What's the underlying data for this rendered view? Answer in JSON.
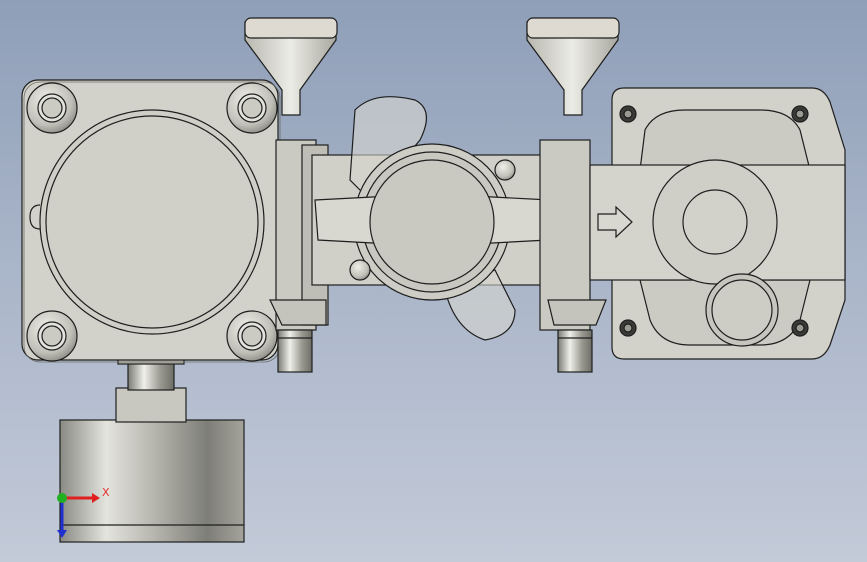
{
  "viewport": {
    "background_top": "#8f9fb8",
    "background_bottom": "#c3cad8"
  },
  "model": {
    "body_color": "#d4d4cc",
    "edge_color": "#1e1e1e",
    "shadow_color": "#9c9c94",
    "flow_arrow_icon": "arrow-right-icon"
  },
  "triad": {
    "x_label": "X",
    "x_color": "#e02020",
    "y_color": "#20b020",
    "z_color": "#2030d0"
  }
}
